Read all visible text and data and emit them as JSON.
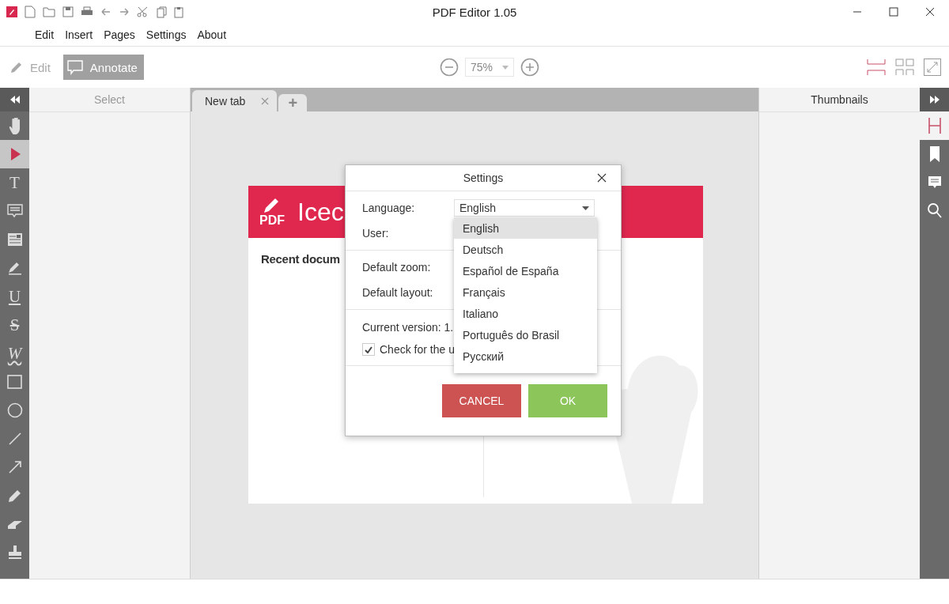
{
  "window": {
    "title": "PDF Editor 1.05"
  },
  "menu": [
    "Edit",
    "Insert",
    "Pages",
    "Settings",
    "About"
  ],
  "toolbar": {
    "modes": [
      {
        "label": "Edit",
        "selected": false
      },
      {
        "label": "Annotate",
        "selected": true
      }
    ],
    "zoom": "75%",
    "layouts": [
      {
        "selected": true
      },
      {
        "selected": false
      }
    ]
  },
  "left_panel": {
    "title": "Select",
    "tools": [
      {
        "selected": false
      },
      {
        "selected": true
      },
      {
        "glyph": "T",
        "selected": false
      },
      {
        "selected": false
      },
      {
        "selected": false
      },
      {
        "selected": false
      },
      {
        "glyph": "U",
        "selected": false
      },
      {
        "glyph": "S",
        "selected": false
      },
      {
        "glyph": "W",
        "selected": false
      },
      {
        "selected": false
      },
      {
        "selected": false
      },
      {
        "selected": false
      },
      {
        "selected": false
      },
      {
        "selected": false
      },
      {
        "selected": false
      },
      {
        "selected": false
      }
    ]
  },
  "tabs": [
    {
      "label": "New tab",
      "selected": true
    }
  ],
  "add_tab": "+",
  "document": {
    "logo_text": "PDF",
    "header_text": "Icec",
    "section_title": "Recent docum"
  },
  "settings_dialog": {
    "title": "Settings",
    "sections": [
      [
        {
          "label": "Language:",
          "value": "English"
        },
        {
          "label": "User:"
        }
      ],
      [
        {
          "label": "Default zoom:"
        },
        {
          "label": "Default layout:"
        }
      ]
    ],
    "version": "Current version: 1.",
    "update_check": {
      "label": "Check for the u",
      "checked": true
    },
    "language_options": [
      {
        "label": "English",
        "selected": true
      },
      {
        "label": "Deutsch",
        "selected": false
      },
      {
        "label": "Español de España",
        "selected": false
      },
      {
        "label": "Français",
        "selected": false
      },
      {
        "label": "Italiano",
        "selected": false
      },
      {
        "label": "Português do Brasil",
        "selected": false
      },
      {
        "label": "Русский",
        "selected": false
      }
    ],
    "buttons": [
      {
        "label": "CANCEL",
        "kind": "cancel"
      },
      {
        "label": "OK",
        "kind": "ok"
      }
    ]
  },
  "right_panel": {
    "title": "Thumbnails",
    "tools": [
      {
        "selected": true
      },
      {
        "selected": false
      },
      {
        "selected": false
      },
      {
        "selected": false
      }
    ]
  }
}
